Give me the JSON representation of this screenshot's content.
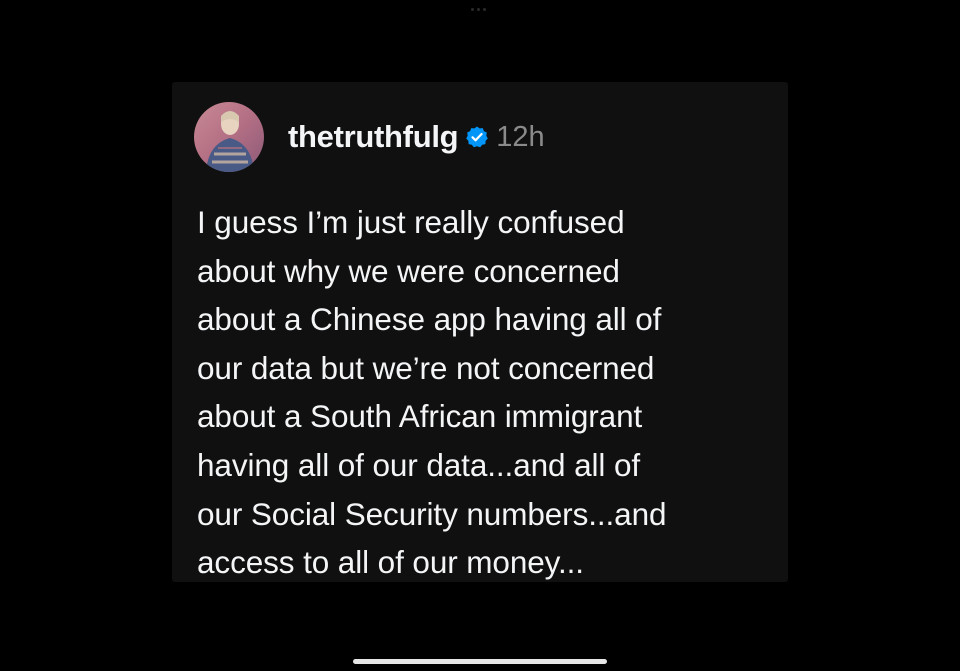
{
  "post": {
    "author": {
      "username": "thetruthfulg",
      "verified_icon": "verified-badge-icon",
      "avatar": "avatar"
    },
    "timestamp": "12h",
    "text_lines": [
      "I guess I’m just really confused",
      "about why we were concerned",
      "about a Chinese app having all of",
      "our data but we’re not concerned",
      "about a South African immigrant",
      "having all of our data...and all of",
      "our Social Security numbers...and",
      "access to all of our money..."
    ]
  },
  "colors": {
    "background": "#000000",
    "card": "#101010",
    "text": "#f3f5f7",
    "muted": "#8a8a8a",
    "verified_blue": "#0095f6"
  }
}
